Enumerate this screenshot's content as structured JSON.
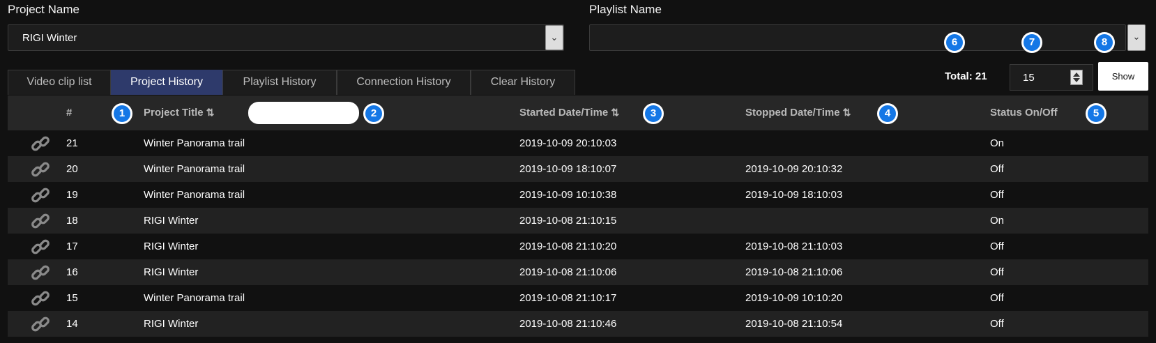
{
  "project": {
    "label": "Project Name",
    "selected": "RIGI Winter"
  },
  "playlist": {
    "label": "Playlist Name",
    "selected": ""
  },
  "tabs": [
    {
      "label": "Video clip list",
      "active": false
    },
    {
      "label": "Project History",
      "active": true
    },
    {
      "label": "Playlist History",
      "active": false
    },
    {
      "label": "Connection History",
      "active": false
    },
    {
      "label": "Clear History",
      "active": false
    }
  ],
  "total": "Total: 21",
  "page_size": "15",
  "show_label": "Show",
  "badges": [
    "1",
    "2",
    "3",
    "4",
    "5",
    "6",
    "7",
    "8"
  ],
  "columns": {
    "num": "#",
    "title": "Project Title",
    "started": "Started Date/Time",
    "stopped": "Stopped Date/Time",
    "status": "Status On/Off",
    "sort_glyph": "⇅"
  },
  "rows": [
    {
      "num": "21",
      "title": "Winter Panorama trail",
      "started": "2019-10-09 20:10:03",
      "stopped": "",
      "status": "On"
    },
    {
      "num": "20",
      "title": "Winter Panorama trail",
      "started": "2019-10-09 18:10:07",
      "stopped": "2019-10-09 20:10:32",
      "status": "Off"
    },
    {
      "num": "19",
      "title": "Winter Panorama trail",
      "started": "2019-10-09 10:10:38",
      "stopped": "2019-10-09 18:10:03",
      "status": "Off"
    },
    {
      "num": "18",
      "title": "RIGI Winter",
      "started": "2019-10-08 21:10:15",
      "stopped": "",
      "status": "On"
    },
    {
      "num": "17",
      "title": "RIGI Winter",
      "started": "2019-10-08 21:10:20",
      "stopped": "2019-10-08 21:10:03",
      "status": "Off"
    },
    {
      "num": "16",
      "title": "RIGI Winter",
      "started": "2019-10-08 21:10:06",
      "stopped": "2019-10-08 21:10:06",
      "status": "Off"
    },
    {
      "num": "15",
      "title": "Winter Panorama trail",
      "started": "2019-10-08 21:10:17",
      "stopped": "2019-10-09 10:10:20",
      "status": "Off"
    },
    {
      "num": "14",
      "title": "RIGI Winter",
      "started": "2019-10-08 21:10:46",
      "stopped": "2019-10-08 21:10:54",
      "status": "Off"
    }
  ],
  "colors": {
    "active_tab": "#2e3a6b",
    "badge": "#1477e6",
    "row_alt": "#222222"
  }
}
